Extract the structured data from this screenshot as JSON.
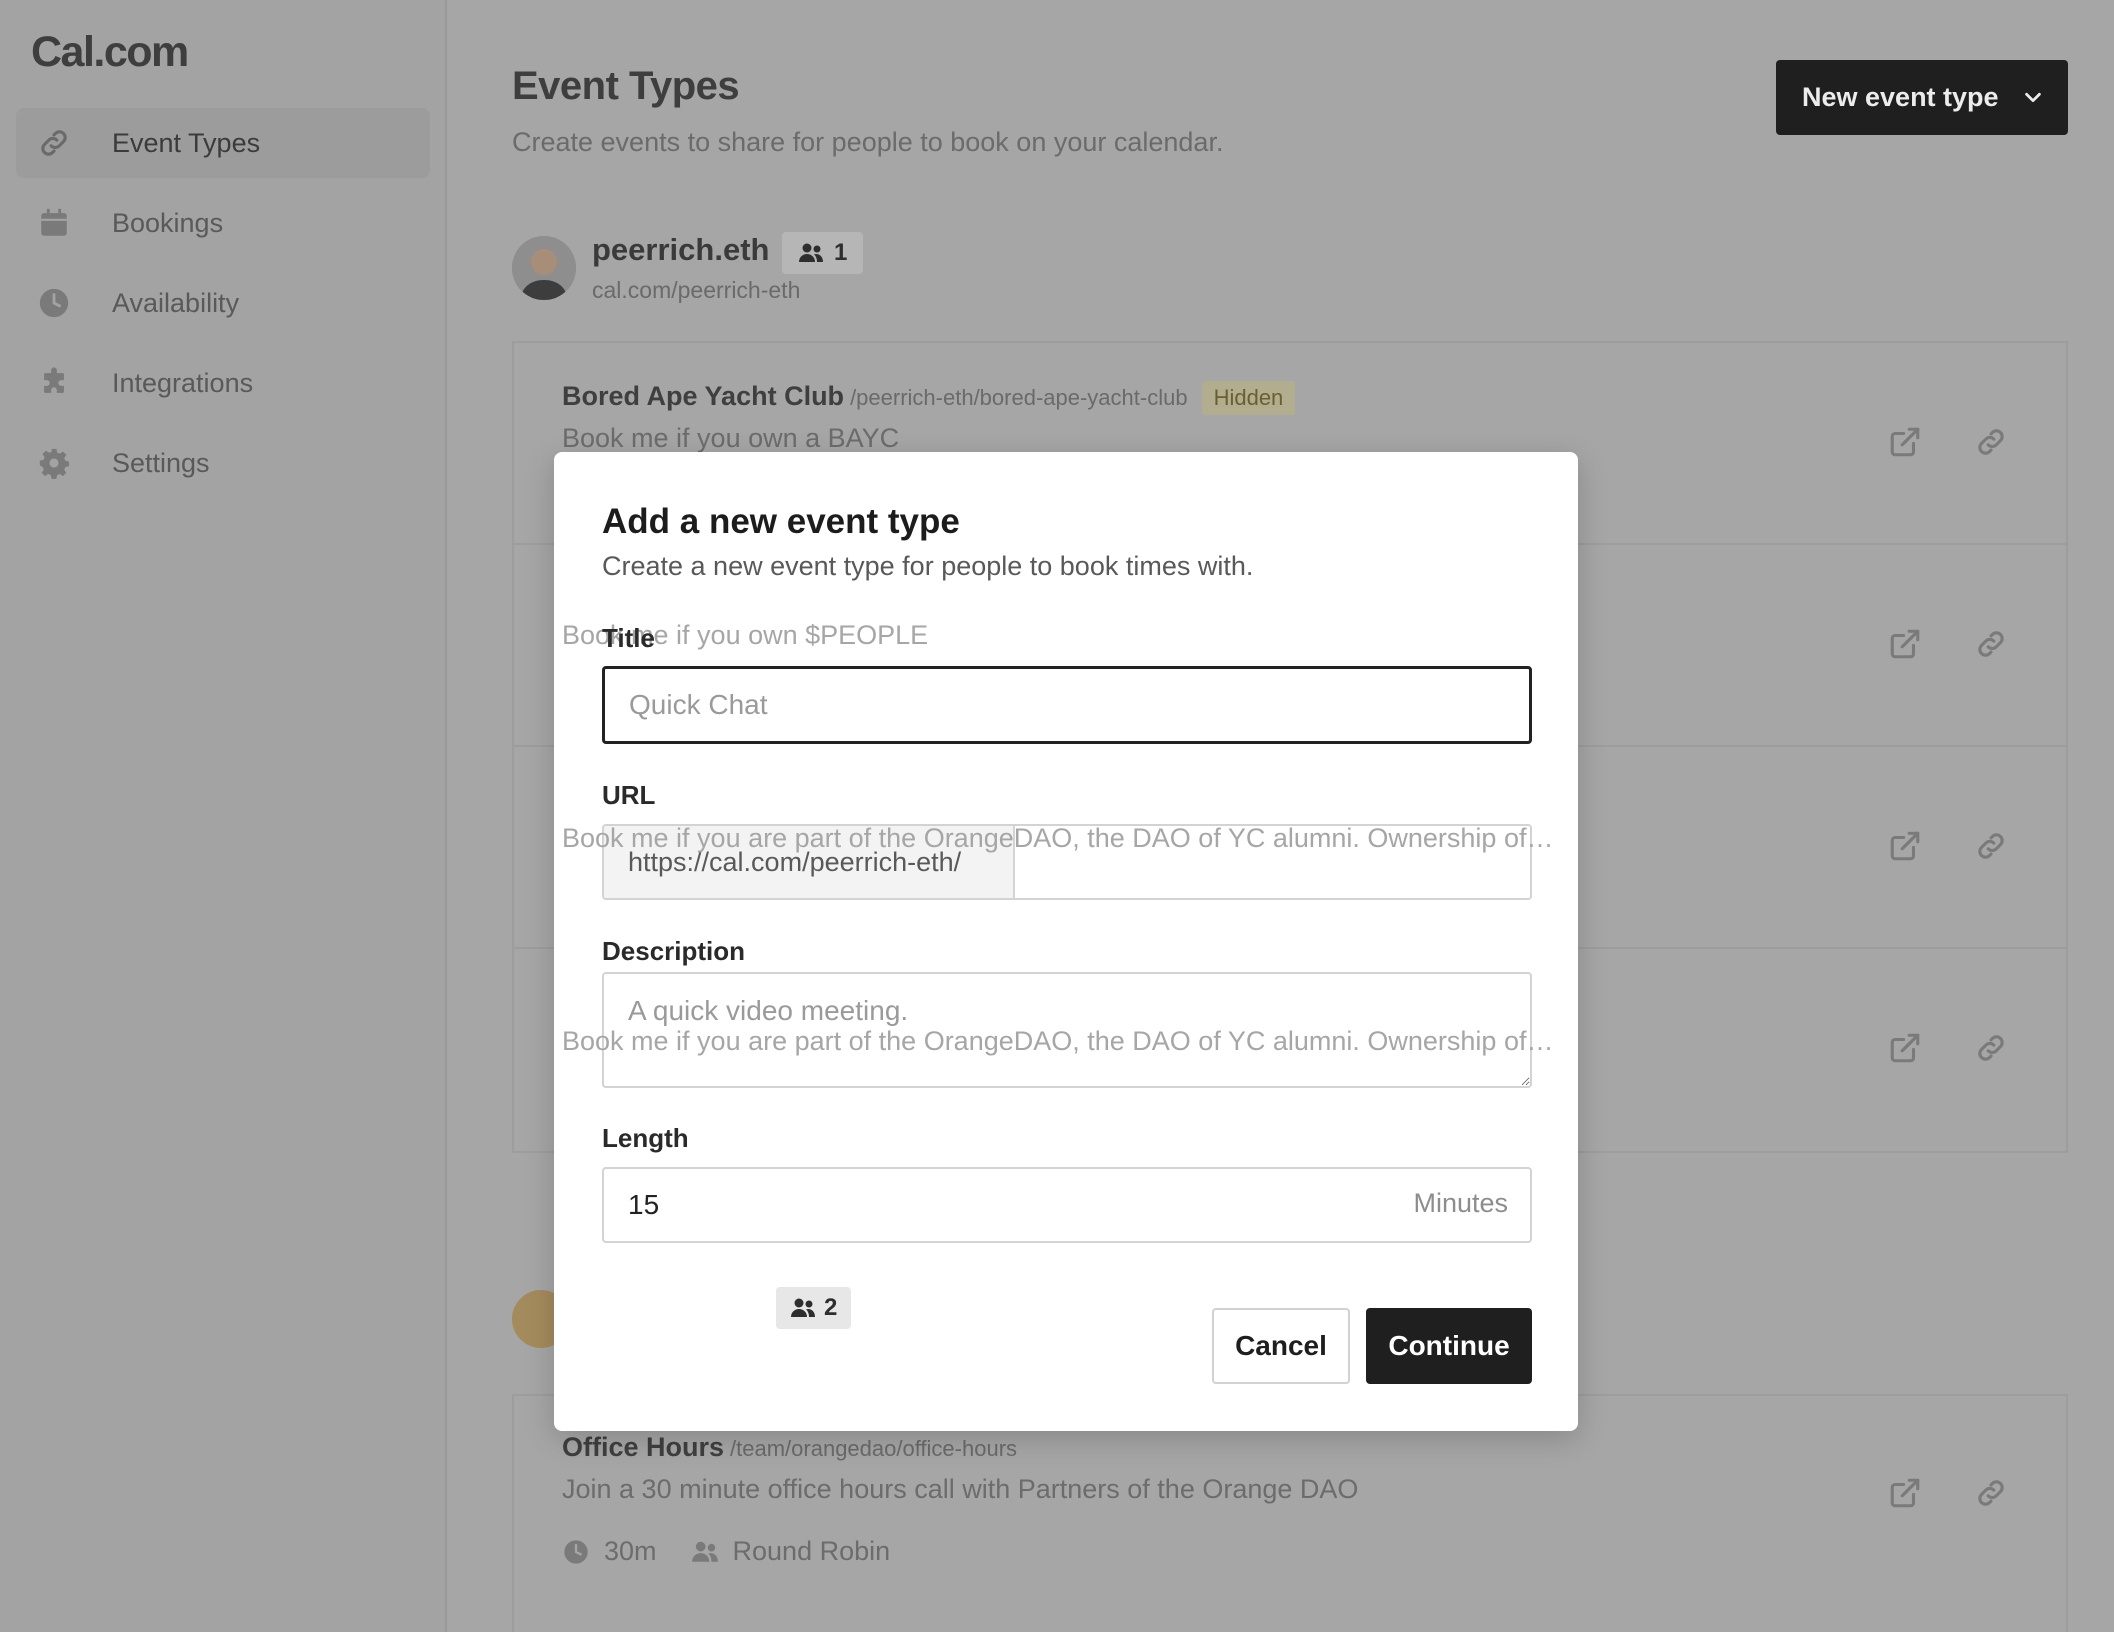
{
  "brand": "Cal.com",
  "sidebar": {
    "items": [
      {
        "label": "Event Types",
        "icon": "link-icon"
      },
      {
        "label": "Bookings",
        "icon": "calendar-icon"
      },
      {
        "label": "Availability",
        "icon": "clock-icon"
      },
      {
        "label": "Integrations",
        "icon": "puzzle-icon"
      },
      {
        "label": "Settings",
        "icon": "gear-icon"
      }
    ]
  },
  "header": {
    "title": "Event Types",
    "subtitle": "Create events to share for people to book on your calendar.",
    "new_button": "New event type"
  },
  "profile": {
    "name": "peerrich.eth",
    "member_count": "1",
    "url": "cal.com/peerrich-eth"
  },
  "events": [
    {
      "title": "Bored Ape Yacht Club",
      "slug": "/peerrich-eth/bored-ape-yacht-club",
      "badge": "Hidden",
      "description": "Book me if you own a BAYC"
    },
    {
      "description": "Book me if you own $PEOPLE"
    },
    {
      "description": "Book me if you are part of the OrangeDAO, the DAO of YC alumni. Ownership of…"
    },
    {
      "description": "Book me if you are part of the OrangeDAO, the DAO of YC alumni. Ownership of…"
    }
  ],
  "team": {
    "member_count": "2",
    "event": {
      "title": "Office Hours",
      "slug": "/team/orangedao/office-hours",
      "description": "Join a 30 minute office hours call with Partners of the Orange DAO",
      "duration": "30m",
      "scheduling": "Round Robin"
    }
  },
  "modal": {
    "title": "Add a new event type",
    "subtitle": "Create a new event type for people to book times with.",
    "title_label": "Title",
    "title_placeholder": "Quick Chat",
    "url_label": "URL",
    "url_prefix": "https://cal.com/peerrich-eth/",
    "description_label": "Description",
    "description_placeholder": "A quick video meeting.",
    "length_label": "Length",
    "length_value": "15",
    "length_unit": "Minutes",
    "cancel": "Cancel",
    "continue": "Continue"
  }
}
